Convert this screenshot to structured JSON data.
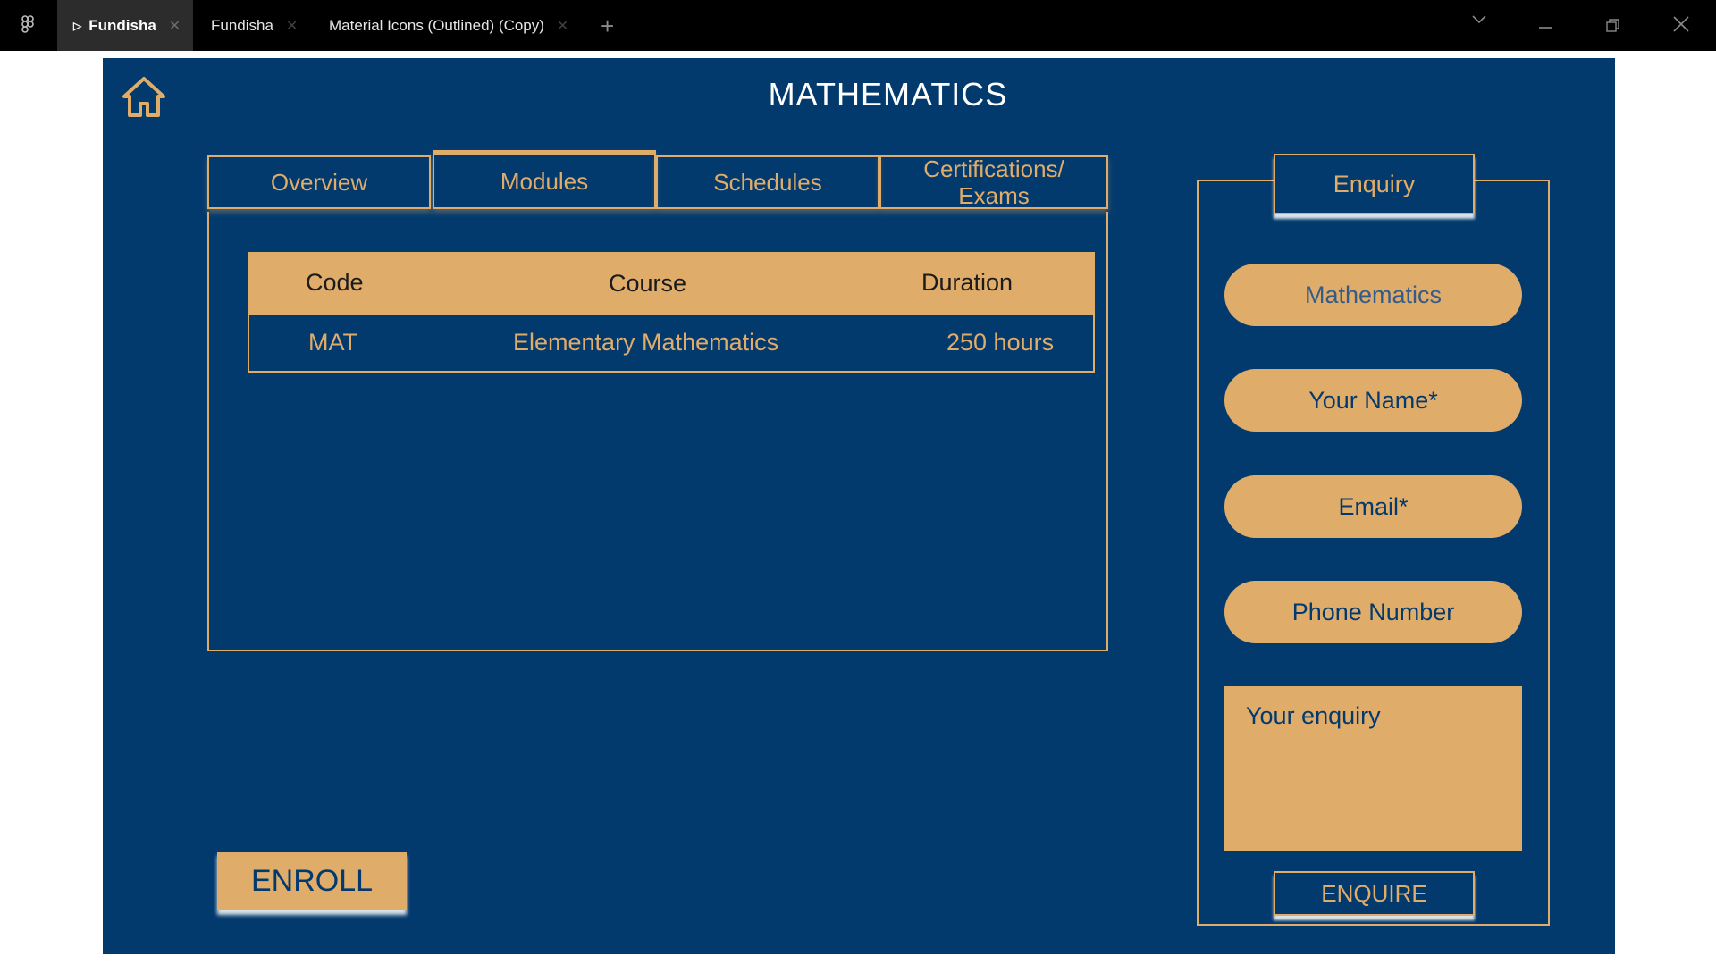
{
  "window": {
    "tabs": [
      {
        "label": "Fundisha",
        "active": true
      },
      {
        "label": "Fundisha",
        "active": false
      },
      {
        "label": "Material Icons (Outlined) (Copy)",
        "active": false
      }
    ]
  },
  "page": {
    "title": "MATHEMATICS"
  },
  "module_tabs": [
    {
      "label": "Overview",
      "active": false
    },
    {
      "label": "Modules",
      "active": true
    },
    {
      "label": "Schedules",
      "active": false
    },
    {
      "label": "Certifications/ Exams",
      "active": false
    }
  ],
  "table": {
    "headers": [
      "Code",
      "Course",
      "Duration"
    ],
    "rows": [
      [
        "MAT",
        "Elementary Mathematics",
        "250 hours"
      ]
    ]
  },
  "enroll": {
    "label": "ENROLL"
  },
  "enquiry": {
    "title": "Enquiry",
    "subject_placeholder": "Mathematics",
    "name_placeholder": "Your Name*",
    "email_placeholder": "Email*",
    "phone_placeholder": "Phone Number",
    "message_placeholder": "Your enquiry",
    "submit_label": "ENQUIRE"
  },
  "colors": {
    "background": "#033a6e",
    "accent": "#e0ac6a",
    "title_text": "#ffffff"
  }
}
